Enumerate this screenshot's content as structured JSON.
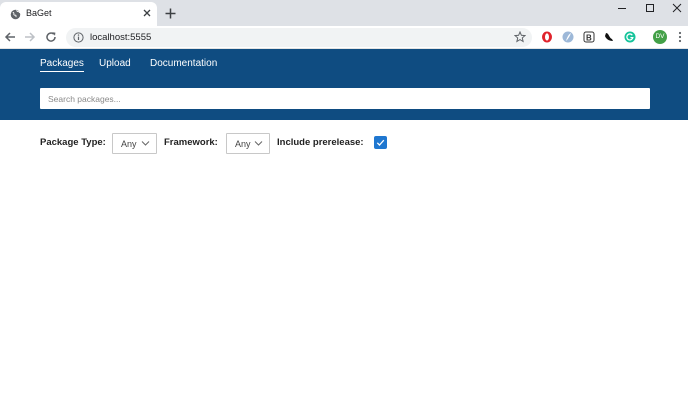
{
  "browser": {
    "tab_title": "BaGet",
    "url": "localhost:5555",
    "profile_initials": "DV"
  },
  "nav": {
    "items": [
      {
        "label": "Packages",
        "active": true
      },
      {
        "label": "Upload",
        "active": false
      },
      {
        "label": "Documentation",
        "active": false
      }
    ]
  },
  "search": {
    "placeholder": "Search packages...",
    "value": ""
  },
  "filters": {
    "package_type_label": "Package Type:",
    "package_type_value": "Any",
    "framework_label": "Framework:",
    "framework_value": "Any",
    "prerelease_label": "Include prerelease:",
    "prerelease_checked": true
  },
  "colors": {
    "header": "#0f4c81",
    "checkbox": "#1f77d0",
    "tabstrip": "#dee1e6"
  }
}
